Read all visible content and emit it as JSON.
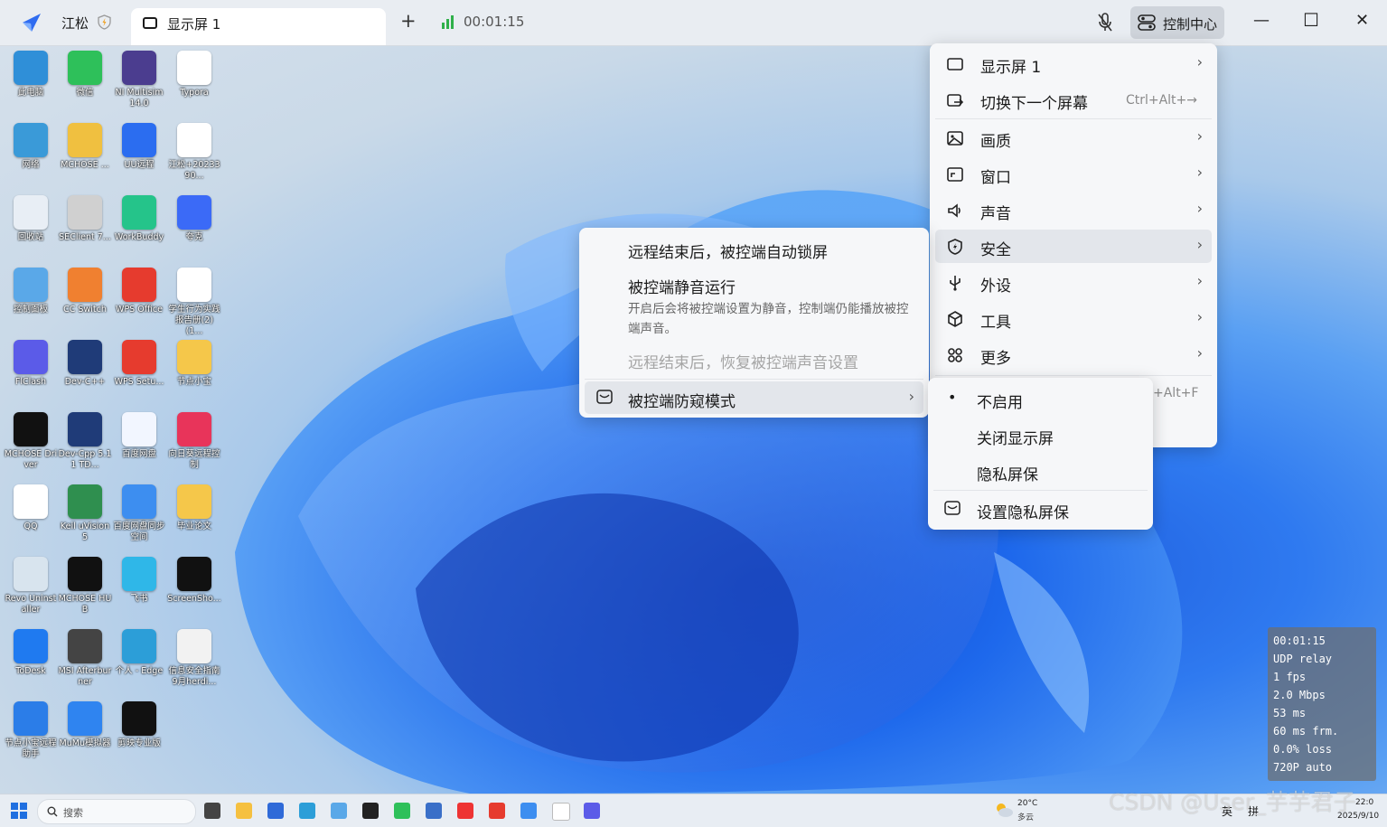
{
  "titlebar": {
    "user_name": "江松",
    "tab_label": "显示屏 1",
    "add_tab": "+",
    "timer": "00:01:15",
    "control_center": "控制中心",
    "minimize": "—",
    "maximize": "☐",
    "close": "✕"
  },
  "desktop_icons": [
    {
      "label": "此电脑",
      "color": "#2f8fd8"
    },
    {
      "label": "微信",
      "color": "#2ec05a"
    },
    {
      "label": "NI Multisim 14.0",
      "color": "#4b3d8f"
    },
    {
      "label": "Typora",
      "color": "#ffffff"
    },
    {
      "label": "网络",
      "color": "#3a9ad8"
    },
    {
      "label": "MCHOSE ...",
      "color": "#f0c040"
    },
    {
      "label": "UU远程",
      "color": "#2b6df0"
    },
    {
      "label": "江松+2023390...",
      "color": "#ffffff"
    },
    {
      "label": "回收站",
      "color": "#e8eef5"
    },
    {
      "label": "SEClient 7...",
      "color": "#d0d0d0"
    },
    {
      "label": "WorkBuddy",
      "color": "#25c48a"
    },
    {
      "label": "夸克",
      "color": "#3b6af7"
    },
    {
      "label": "控制面板",
      "color": "#5aa8e8"
    },
    {
      "label": "CC Switch",
      "color": "#f08030"
    },
    {
      "label": "WPS Office",
      "color": "#e63b2e"
    },
    {
      "label": "学生行为实践报告册(2)(1...",
      "color": "#ffffff"
    },
    {
      "label": "FlClash",
      "color": "#5b5be8"
    },
    {
      "label": "Dev-C++",
      "color": "#1f3b78"
    },
    {
      "label": "WPS Setu...",
      "color": "#e63b2e"
    },
    {
      "label": "节点小宝",
      "color": "#f5c74a"
    },
    {
      "label": "MCHOSE Driver",
      "color": "#111111"
    },
    {
      "label": "Dev-Cpp 5.11 TD...",
      "color": "#1f3b78"
    },
    {
      "label": "百度网盘",
      "color": "#f2f6ff"
    },
    {
      "label": "向日葵远程控制",
      "color": "#e8345a"
    },
    {
      "label": "QQ",
      "color": "#ffffff"
    },
    {
      "label": "Keil uVision5",
      "color": "#2f8f4f"
    },
    {
      "label": "百度网盘同步空间",
      "color": "#3d8ef0"
    },
    {
      "label": "毕业论文",
      "color": "#f5c74a"
    },
    {
      "label": "Revo Uninstaller",
      "color": "#d8e4ee"
    },
    {
      "label": "MCHOSE HUB",
      "color": "#111111"
    },
    {
      "label": "飞书",
      "color": "#2fb7e8"
    },
    {
      "label": "ScreenSho...",
      "color": "#111111"
    },
    {
      "label": "ToDesk",
      "color": "#1f7af0"
    },
    {
      "label": "MSI Afterburner",
      "color": "#444444"
    },
    {
      "label": "个人 - Edge",
      "color": "#2c9ed8"
    },
    {
      "label": "信息安全指南9月herdi...",
      "color": "#f2f2f2"
    },
    {
      "label": "节点小宝远程助手",
      "color": "#2b7de8"
    },
    {
      "label": "MuMu模拟器",
      "color": "#2f84f0"
    },
    {
      "label": "剪映专业版",
      "color": "#111111"
    }
  ],
  "main_menu": [
    {
      "label": "显示屏 1",
      "icon": "monitor-icon",
      "chevron": true,
      "shortcut": ""
    },
    {
      "label": "切换下一个屏幕",
      "icon": "switch-screen-icon",
      "chevron": false,
      "shortcut": "Ctrl+Alt+→"
    },
    {
      "label": "画质",
      "icon": "image-quality-icon",
      "chevron": true,
      "shortcut": ""
    },
    {
      "label": "窗口",
      "icon": "window-icon",
      "chevron": true,
      "shortcut": ""
    },
    {
      "label": "声音",
      "icon": "speaker-icon",
      "chevron": true,
      "shortcut": ""
    },
    {
      "label": "安全",
      "icon": "shield-icon",
      "chevron": true,
      "shortcut": ""
    },
    {
      "label": "外设",
      "icon": "usb-icon",
      "chevron": true,
      "shortcut": ""
    },
    {
      "label": "工具",
      "icon": "cube-icon",
      "chevron": true,
      "shortcut": ""
    },
    {
      "label": "更多",
      "icon": "grid-icon",
      "chevron": true,
      "shortcut": ""
    }
  ],
  "hidden_shortcut": "+Alt+F",
  "security_menu": {
    "item1": "远程结束后，被控端自动锁屏",
    "item2_title": "被控端静音运行",
    "item2_desc": "开启后会将被控端设置为静音，控制端仍能播放被控端声音。",
    "item3": "远程结束后，恢复被控端声音设置",
    "item4": "被控端防窥模式"
  },
  "privacy_menu": {
    "bullet": "•",
    "item1": "不启用",
    "item2": "关闭显示屏",
    "item3": "隐私屏保",
    "item4": "设置隐私屏保"
  },
  "stats": [
    "00:01:15",
    "UDP relay",
    "1 fps",
    "2.0 Mbps",
    "53 ms",
    "60 ms frm.",
    "0.0% loss",
    "720P auto"
  ],
  "taskbar": {
    "search_placeholder": "搜索",
    "weather_temp": "20°C",
    "weather_desc": "多云",
    "ime1": "英",
    "ime2": "拼",
    "time": "22:0",
    "date": "2025/9/10"
  },
  "watermark": "CSDN @User_芋芋君子",
  "colors": {
    "accent": "#2f7af0",
    "menu_bg": "#f6f7f9",
    "highlight": "#e3e6eb"
  }
}
